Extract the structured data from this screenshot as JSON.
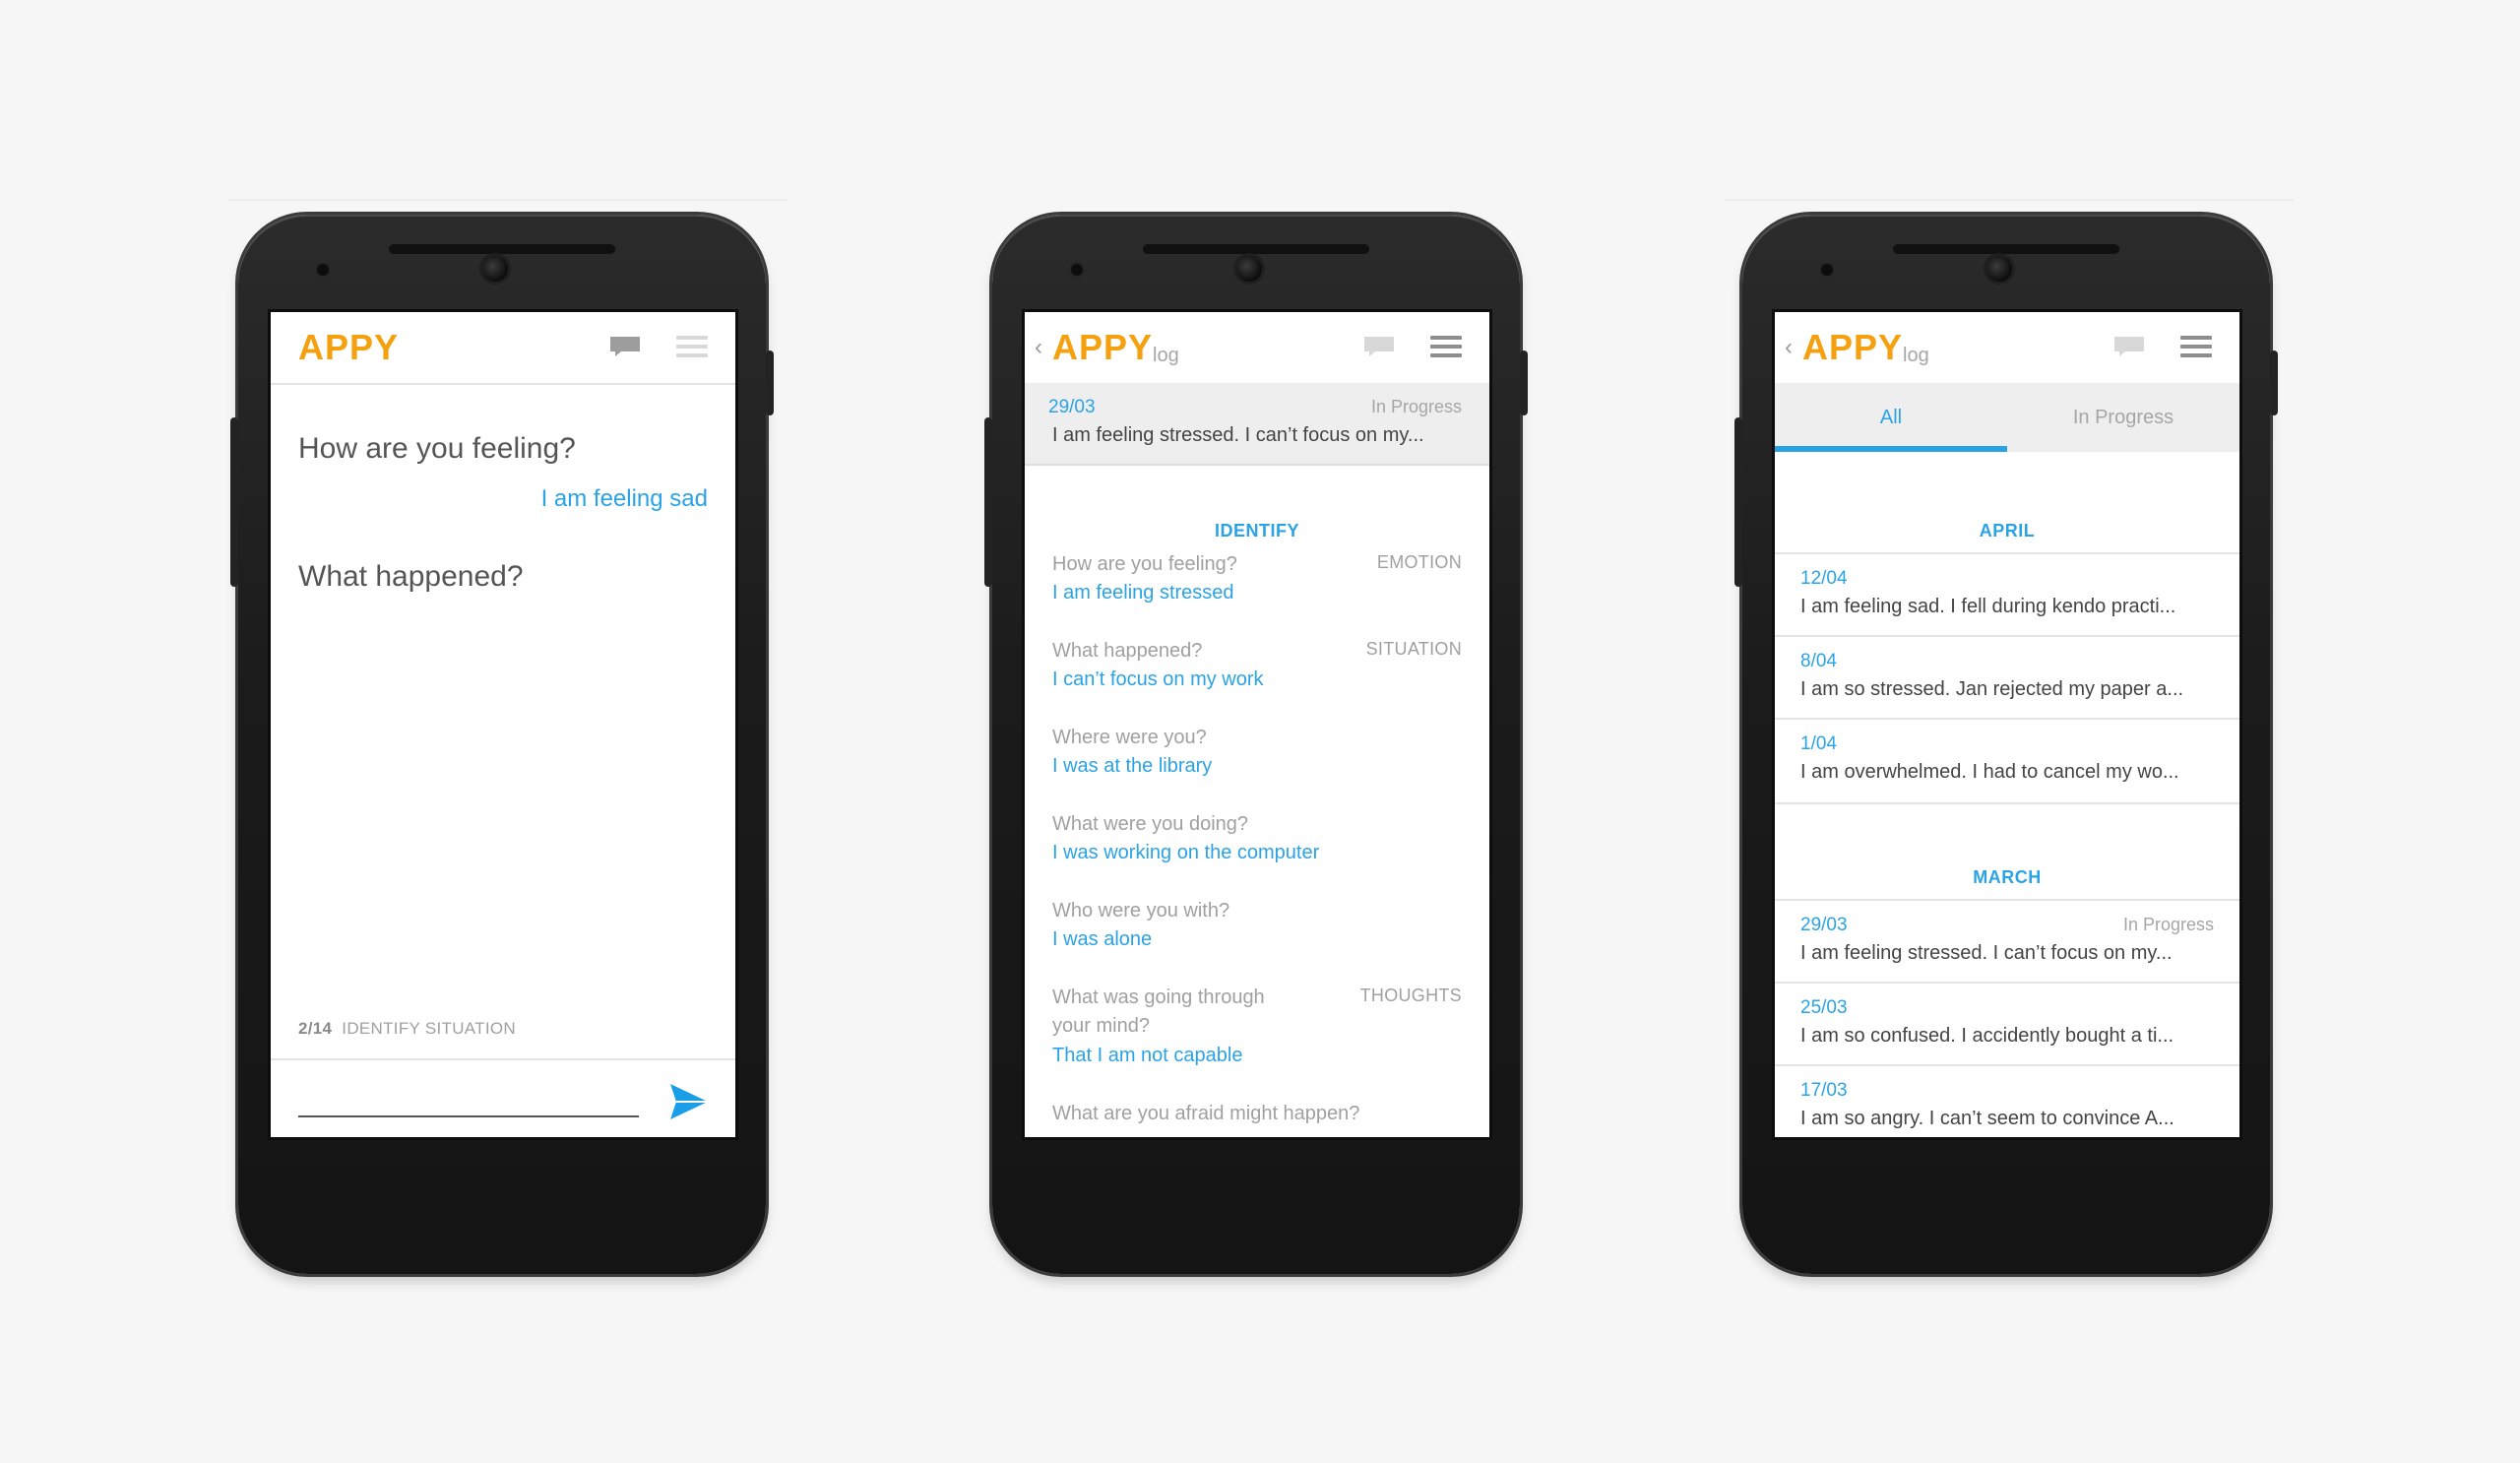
{
  "brand": {
    "name": "APPY",
    "sub": "log",
    "accent": "#f5a00f",
    "link_color": "#2aa3e6"
  },
  "icons": {
    "back": "back-chevron-icon",
    "chat": "chat-bubble-icon",
    "menu": "hamburger-menu-icon",
    "send": "send-icon"
  },
  "screen1": {
    "question1": "How are you feeling?",
    "answer1": "I am feeling sad",
    "question2": "What happened?",
    "step_count": "2/14",
    "step_label": "IDENTIFY SITUATION",
    "input_value": ""
  },
  "screen2": {
    "entry": {
      "date": "29/03",
      "status": "In Progress",
      "text": "I am feeling stressed. I can’t focus on my..."
    },
    "section": "IDENTIFY",
    "qa": [
      {
        "q": "How are you feeling?",
        "a": "I am feeling stressed",
        "tag": "EMOTION"
      },
      {
        "q": "What happened?",
        "a": "I can’t focus on my work",
        "tag": "SITUATION"
      },
      {
        "q": "Where were you?",
        "a": "I was at the library",
        "tag": ""
      },
      {
        "q": "What were you doing?",
        "a": "I was working on the computer",
        "tag": ""
      },
      {
        "q": "Who were you with?",
        "a": "I was alone",
        "tag": ""
      },
      {
        "q_line1": "What was going through",
        "q_line2": "your mind?",
        "a": "That I am not capable",
        "tag": "THOUGHTS"
      },
      {
        "q": "What are you afraid might happen?",
        "a": "",
        "tag": ""
      }
    ]
  },
  "screen3": {
    "tabs": [
      {
        "label": "All",
        "active": true
      },
      {
        "label": "In Progress",
        "active": false
      }
    ],
    "groups": [
      {
        "month": "APRIL",
        "entries": [
          {
            "date": "12/04",
            "status": "",
            "text": "I am feeling sad. I fell during kendo practi..."
          },
          {
            "date": "8/04",
            "status": "",
            "text": "I am so stressed. Jan rejected my paper a..."
          },
          {
            "date": "1/04",
            "status": "",
            "text": "I am overwhelmed. I had to cancel my wo..."
          }
        ]
      },
      {
        "month": "MARCH",
        "entries": [
          {
            "date": "29/03",
            "status": "In Progress",
            "text": "I am feeling stressed. I can’t focus on my..."
          },
          {
            "date": "25/03",
            "status": "",
            "text": "I am so confused. I accidently bought a ti..."
          },
          {
            "date": "17/03",
            "status": "",
            "text": "I am so angry. I can’t seem to convince A..."
          }
        ]
      }
    ]
  }
}
